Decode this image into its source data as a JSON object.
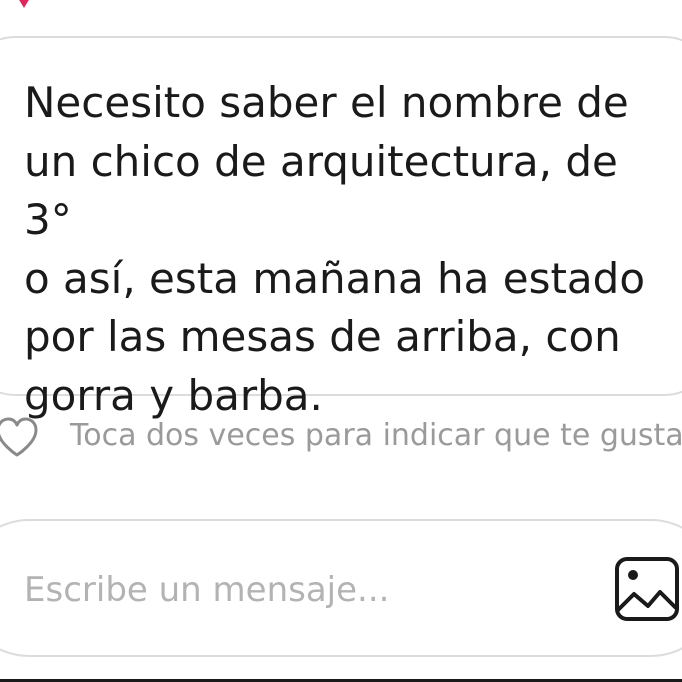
{
  "message": {
    "text": "Necesito saber el nombre de\nun chico de arquitectura, de 3°\no así, esta mañana ha estado\npor las mesas de arriba, con\ngorra y barba."
  },
  "like": {
    "icon": "heart-outline-icon",
    "hint": "Toca dos veces para indicar que te gusta"
  },
  "composer": {
    "placeholder": "Escribe un mensaje...",
    "image_icon": "image-gallery-icon"
  },
  "colors": {
    "accent": "#e0245e",
    "text": "#1a1a1a",
    "hint": "#9a9a9a",
    "border": "#dcdcdc"
  }
}
